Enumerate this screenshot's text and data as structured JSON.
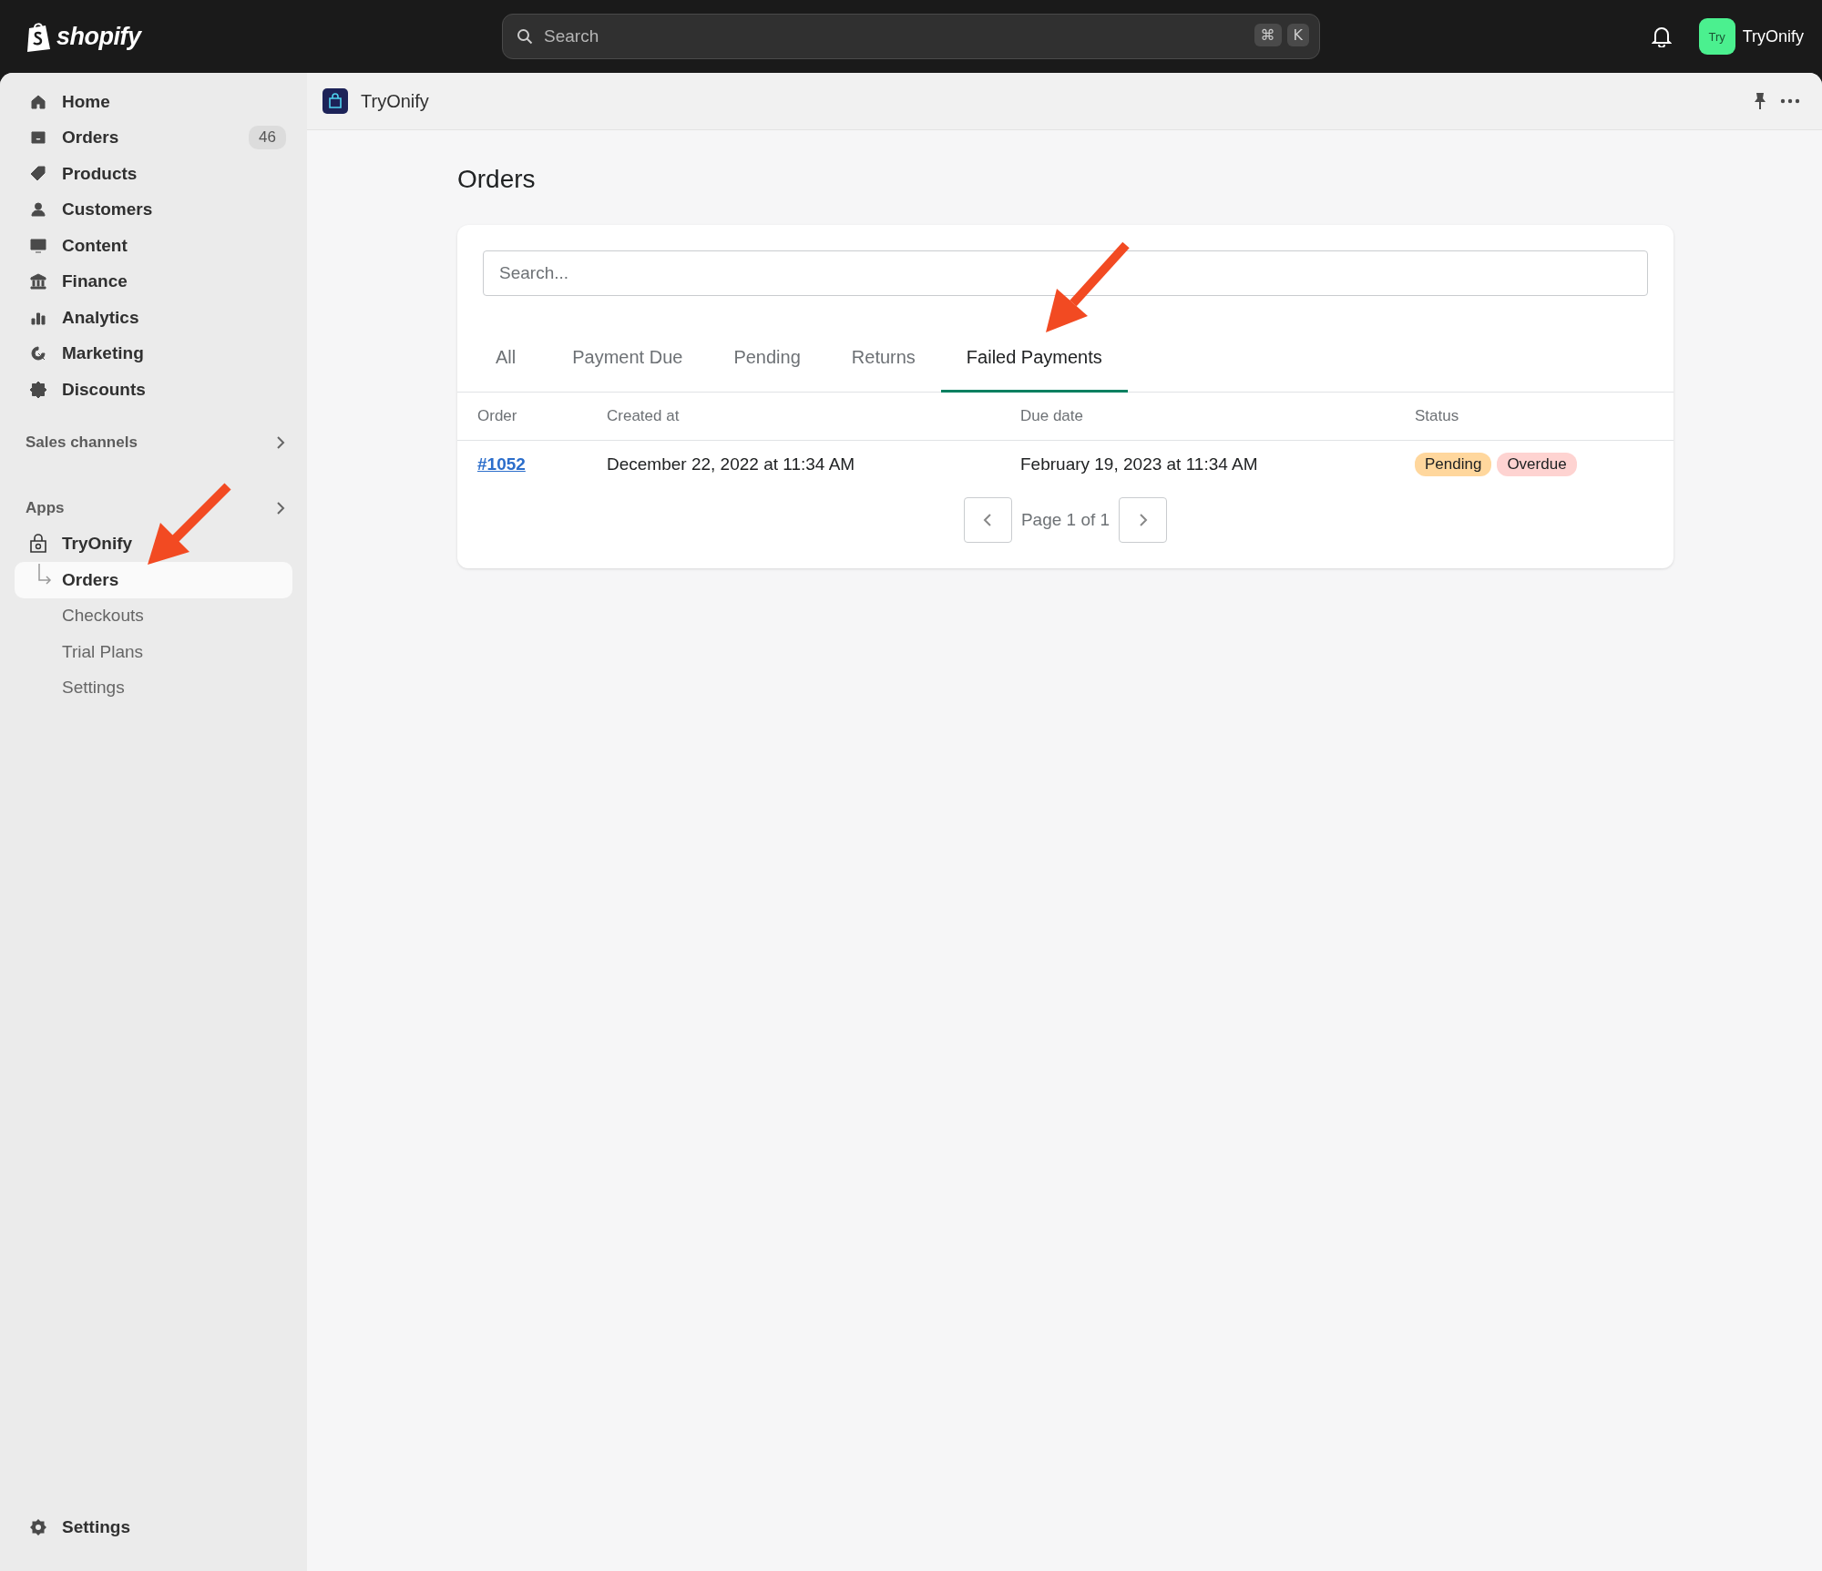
{
  "topbar": {
    "logo": "shopify",
    "search": {
      "placeholder": "Search",
      "shortcut_keys": [
        "⌘",
        "K"
      ]
    },
    "store": {
      "avatar": "Try",
      "name": "TryOnify"
    }
  },
  "sidebar": {
    "items": [
      {
        "label": "Home"
      },
      {
        "label": "Orders",
        "badge": "46"
      },
      {
        "label": "Products"
      },
      {
        "label": "Customers"
      },
      {
        "label": "Content"
      },
      {
        "label": "Finance"
      },
      {
        "label": "Analytics"
      },
      {
        "label": "Marketing"
      },
      {
        "label": "Discounts"
      }
    ],
    "sections": [
      {
        "title": "Sales channels"
      },
      {
        "title": "Apps"
      }
    ],
    "app": {
      "label": "TryOnify",
      "children": [
        {
          "label": "Orders",
          "selected": true
        },
        {
          "label": "Checkouts",
          "selected": false
        },
        {
          "label": "Trial Plans",
          "selected": false
        },
        {
          "label": "Settings",
          "selected": false
        }
      ]
    },
    "footer": {
      "label": "Settings"
    }
  },
  "app_header": {
    "title": "TryOnify"
  },
  "page": {
    "title": "Orders",
    "search": {
      "placeholder": "Search..."
    },
    "tabs": [
      {
        "label": "All",
        "selected": false
      },
      {
        "label": "Payment Due",
        "selected": false
      },
      {
        "label": "Pending",
        "selected": false
      },
      {
        "label": "Returns",
        "selected": false
      },
      {
        "label": "Failed Payments",
        "selected": true
      }
    ],
    "table": {
      "columns": [
        "Order",
        "Created at",
        "Due date",
        "Status"
      ],
      "rows": [
        {
          "order": "#1052",
          "created_at": "December 22, 2022 at 11:34 AM",
          "due_date": "February 19, 2023 at 11:34 AM",
          "statuses": [
            {
              "label": "Pending",
              "kind": "pending"
            },
            {
              "label": "Overdue",
              "kind": "overdue"
            }
          ]
        }
      ]
    },
    "pagination": {
      "label": "Page 1 of 1"
    }
  }
}
